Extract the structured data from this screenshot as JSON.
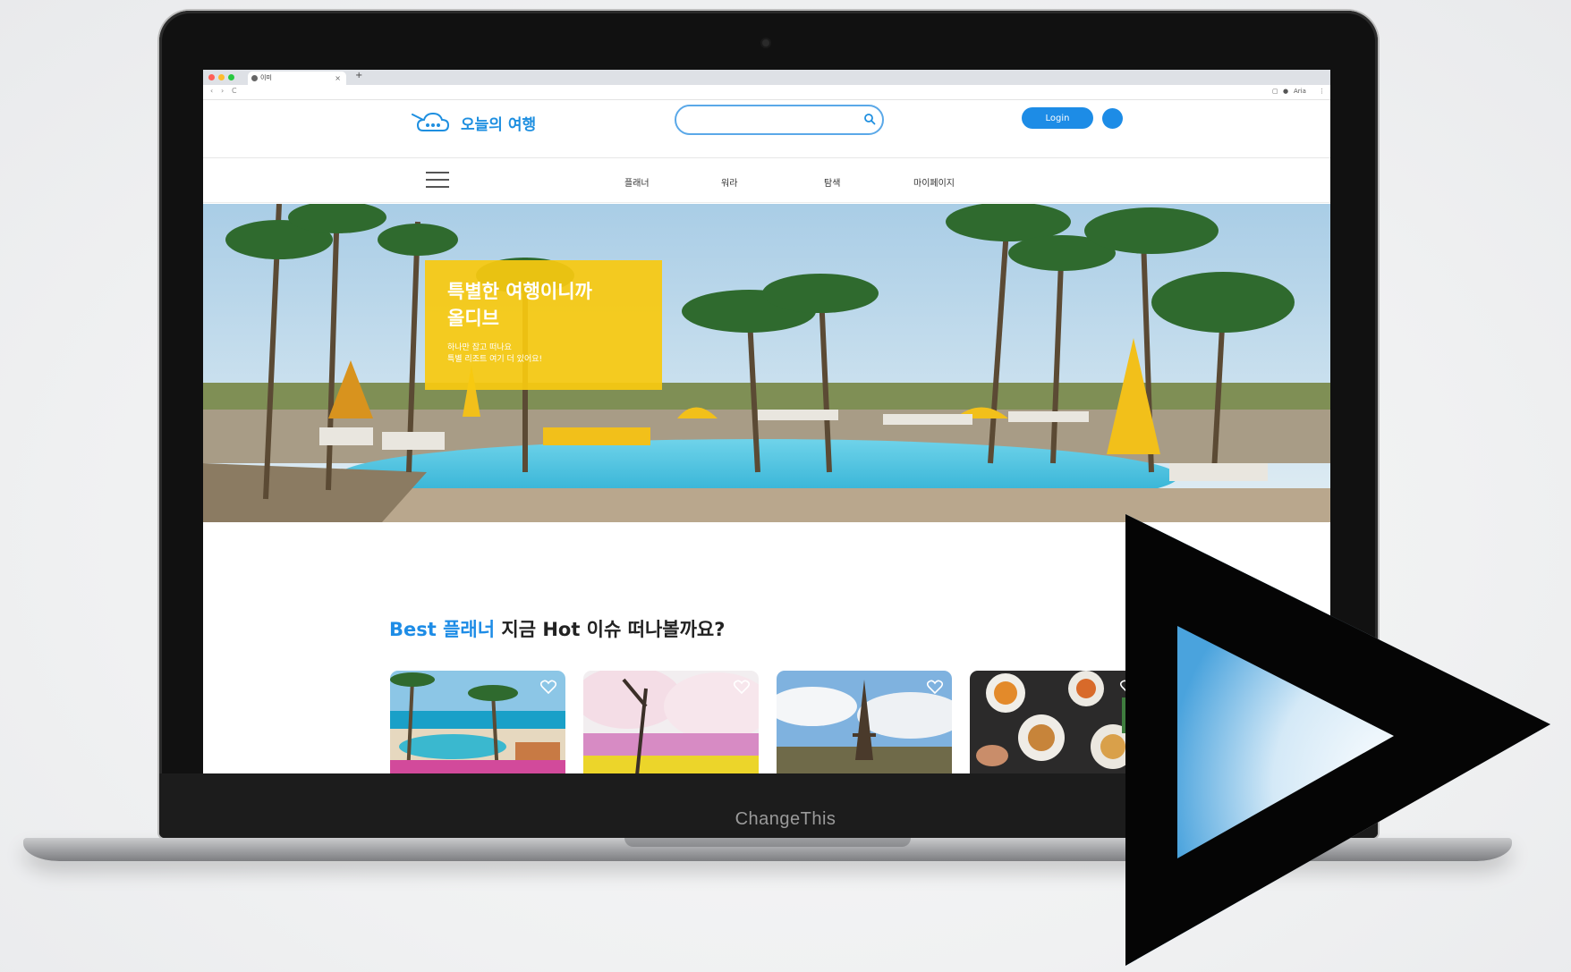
{
  "device": {
    "brand": "ChangeThis"
  },
  "browser": {
    "tab_title": "이미",
    "tab_close": "×",
    "new_tab": "+",
    "back": "‹",
    "forward": "›",
    "reload": "C",
    "right_label": "Aria"
  },
  "site": {
    "logo_text": "오늘의 여행",
    "search_placeholder": "",
    "login_label": "Login",
    "menu": [
      "플래너",
      "워라",
      "탐색",
      "마이페이지"
    ]
  },
  "hero": {
    "title": "특별한 여행이니까\n올디브",
    "subtitle": "하나만 잡고 떠나요\n특별 리조트 여기 더 있어요!"
  },
  "section": {
    "title_highlight": "Best 플래너",
    "title_rest": " 지금 Hot 이슈 떠나볼까요?"
  },
  "cards": [
    {
      "theme": "beach-resort"
    },
    {
      "theme": "cherry-blossom"
    },
    {
      "theme": "eiffel-tower"
    },
    {
      "theme": "food"
    }
  ],
  "colors": {
    "accent": "#1d8ce6",
    "hero_card": "#f7c910",
    "logo": "#1e8fe0"
  }
}
